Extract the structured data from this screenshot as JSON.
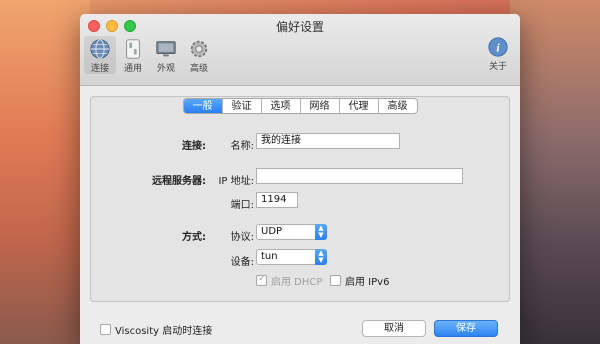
{
  "window": {
    "title": "偏好设置"
  },
  "toolbar": {
    "items": [
      {
        "label": "连接",
        "icon": "globe-icon"
      },
      {
        "label": "通用",
        "icon": "switch-icon"
      },
      {
        "label": "外观",
        "icon": "monitor-icon"
      },
      {
        "label": "高级",
        "icon": "gear-icon"
      }
    ],
    "about": {
      "label": "关于",
      "icon": "info-icon"
    }
  },
  "tabs": [
    "一般",
    "验证",
    "选项",
    "网络",
    "代理",
    "高级"
  ],
  "connection": {
    "section_label": "连接:",
    "name_label": "名称:",
    "name_value": "我的连接"
  },
  "remote_server": {
    "section_label": "远程服务器:",
    "ip_label": "IP 地址:",
    "ip_value": "",
    "port_label": "端口:",
    "port_value": "1194"
  },
  "method": {
    "section_label": "方式:",
    "protocol_label": "协议:",
    "protocol_value": "UDP",
    "device_label": "设备:",
    "device_value": "tun"
  },
  "options": {
    "dhcp_label": "启用 DHCP",
    "ipv6_label": "启用 IPv6"
  },
  "footer": {
    "startup_label": "Viscosity 启动时连接",
    "cancel_label": "取消",
    "save_label": "保存"
  },
  "colors": {
    "accent": "#2a7ff0",
    "window_bg": "#ececec"
  }
}
